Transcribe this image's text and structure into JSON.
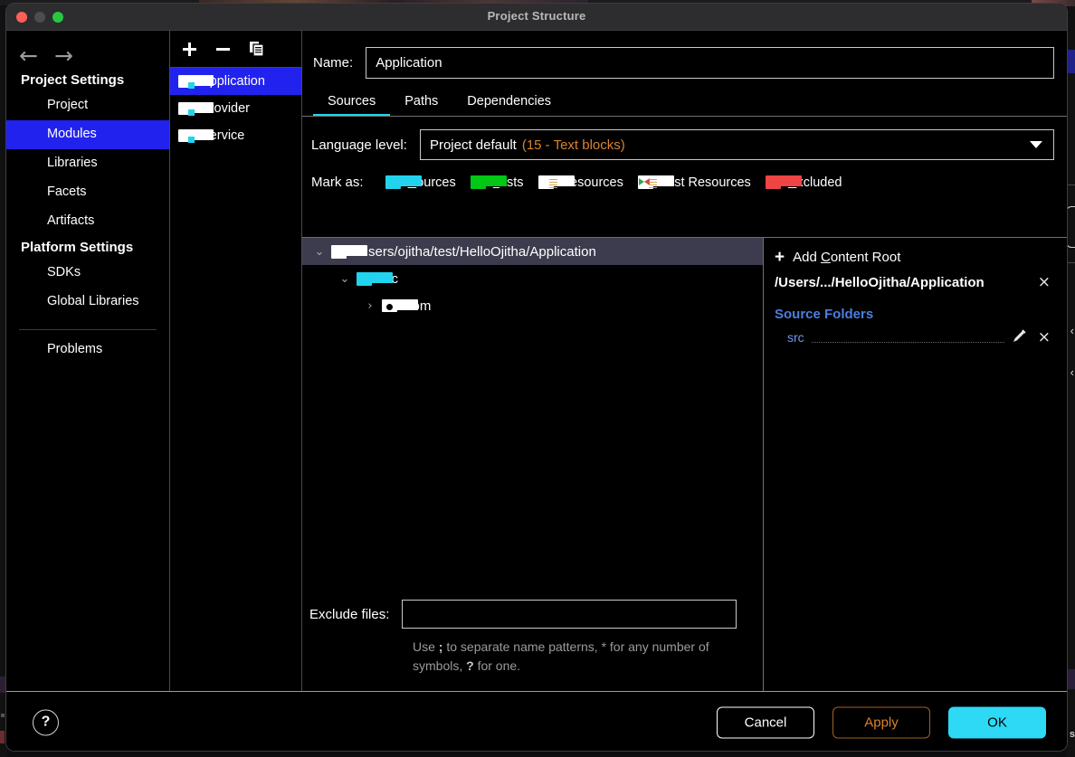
{
  "window": {
    "title": "Project Structure",
    "traffic_lights": [
      "close",
      "minimize",
      "zoom"
    ]
  },
  "sidebar": {
    "back_icon": "←",
    "forward_icon": "→",
    "groups": [
      {
        "heading": "Project Settings",
        "items": [
          {
            "label": "Project",
            "selected": false
          },
          {
            "label": "Modules",
            "selected": true
          },
          {
            "label": "Libraries",
            "selected": false
          },
          {
            "label": "Facets",
            "selected": false
          },
          {
            "label": "Artifacts",
            "selected": false
          }
        ]
      },
      {
        "heading": "Platform Settings",
        "items": [
          {
            "label": "SDKs",
            "selected": false
          },
          {
            "label": "Global Libraries",
            "selected": false
          }
        ]
      }
    ],
    "footer_item": "Problems"
  },
  "modules_panel": {
    "toolbar": {
      "add_label": "+",
      "remove_label": "−",
      "copy_icon": "copy-icon"
    },
    "items": [
      {
        "label": "Application",
        "selected": true
      },
      {
        "label": "Provider",
        "selected": false
      },
      {
        "label": "Service",
        "selected": false
      }
    ]
  },
  "main": {
    "name_label": "Name:",
    "name_value": "Application",
    "tabs": [
      {
        "label": "Sources",
        "active": true
      },
      {
        "label": "Paths",
        "active": false
      },
      {
        "label": "Dependencies",
        "active": false
      }
    ],
    "language_level": {
      "label": "Language level:",
      "value": "Project default",
      "value_detail": "(15 - Text blocks)"
    },
    "mark_as": {
      "label": "Mark as:",
      "options": [
        {
          "label": "Sources",
          "mnemonic": "S",
          "rest": "ources",
          "color": "#22d3ee",
          "kind": "plain"
        },
        {
          "label": "Tests",
          "mnemonic": "T",
          "rest": "ests",
          "color": "#00c814",
          "kind": "plain"
        },
        {
          "label": "Resources",
          "mnemonic": "",
          "rest": "Resources",
          "color": "#ffffff",
          "kind": "resources"
        },
        {
          "label": "Test Resources",
          "mnemonic": "",
          "rest": "Test Resources",
          "color": "#ffffff",
          "kind": "test-resources"
        },
        {
          "label": "Excluded",
          "mnemonic": "E",
          "rest": "xcluded",
          "color": "#ef4444",
          "kind": "plain"
        }
      ]
    },
    "tree": [
      {
        "label": "/Users/ojitha/test/HelloOjitha/Application",
        "depth": 0,
        "expanded": true,
        "icon": "folder-white",
        "selected": true
      },
      {
        "label": "src",
        "depth": 1,
        "expanded": true,
        "icon": "folder-cyan",
        "selected": false
      },
      {
        "label": "com",
        "depth": 2,
        "expanded": false,
        "icon": "folder-package",
        "selected": false
      }
    ],
    "exclude": {
      "label": "Exclude files:",
      "value": "",
      "hint_before": "Use ",
      "hint_semicolon": ";",
      "hint_middle": " to separate name patterns, * for any number of symbols, ",
      "hint_question": "?",
      "hint_after": " for one."
    }
  },
  "detail": {
    "add_content_root": {
      "plus": "+",
      "prefix": "Add ",
      "mnemonic": "C",
      "suffix": "ontent Root"
    },
    "content_root_path": "/Users/.../HelloOjitha/Application",
    "remove_icon": "×",
    "source_folders_heading": "Source Folders",
    "source_folders": [
      {
        "name": "src",
        "edit_icon": "pencil-icon",
        "remove_icon": "×"
      }
    ]
  },
  "footer": {
    "help_label": "?",
    "buttons": [
      {
        "label": "Cancel",
        "style": "cancel"
      },
      {
        "label": "Apply",
        "style": "apply"
      },
      {
        "label": "OK",
        "style": "ok"
      }
    ]
  },
  "colors": {
    "selection_blue": "#2222ee",
    "accent_cyan": "#22d3ee",
    "accent_orange": "#d9832f",
    "link_blue": "#4a7fe0",
    "tree_selection": "#3c3c4e"
  }
}
